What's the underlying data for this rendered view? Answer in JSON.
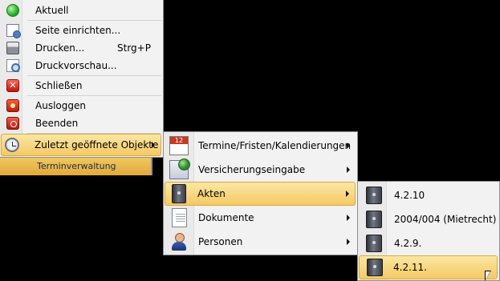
{
  "status_strip": {
    "label": "Terminverwaltung"
  },
  "main_menu": {
    "items": [
      {
        "label": "Aktuell",
        "icon": "green-circle-icon"
      },
      {
        "label": "Seite einrichten...",
        "icon": "page-setup-icon"
      },
      {
        "label": "Drucken...",
        "shortcut": "Strg+P",
        "icon": "printer-icon"
      },
      {
        "label": "Druckvorschau...",
        "icon": "print-preview-icon"
      },
      {
        "label": "Schließen",
        "icon": "close-icon"
      },
      {
        "label": "Ausloggen",
        "icon": "logout-icon"
      },
      {
        "label": "Beenden",
        "icon": "power-icon"
      },
      {
        "label": "Zuletzt geöffnete Objekte",
        "icon": "clock-icon",
        "highlighted": true
      }
    ]
  },
  "recent_menu": {
    "items": [
      {
        "label": "Termine/Fristen/Kalendierungen",
        "icon": "calendar-icon"
      },
      {
        "label": "Versicherungseingabe",
        "icon": "mail-globe-icon"
      },
      {
        "label": "Akten",
        "icon": "binder-icon",
        "highlighted": true
      },
      {
        "label": "Dokumente",
        "icon": "document-icon"
      },
      {
        "label": "Personen",
        "icon": "person-icon"
      }
    ]
  },
  "akten_menu": {
    "items": [
      {
        "label": "4.2.10",
        "icon": "binder-icon"
      },
      {
        "label": "2004/004 (Mietrecht)",
        "icon": "binder-icon"
      },
      {
        "label": "4.2.9.",
        "icon": "binder-icon"
      },
      {
        "label": "4.2.11.",
        "icon": "binder-icon",
        "highlighted": true
      }
    ]
  },
  "colors": {
    "highlight_top": "#fbe7a3",
    "highlight_bottom": "#f4c964",
    "menu_bg": "#f2f2f2"
  }
}
